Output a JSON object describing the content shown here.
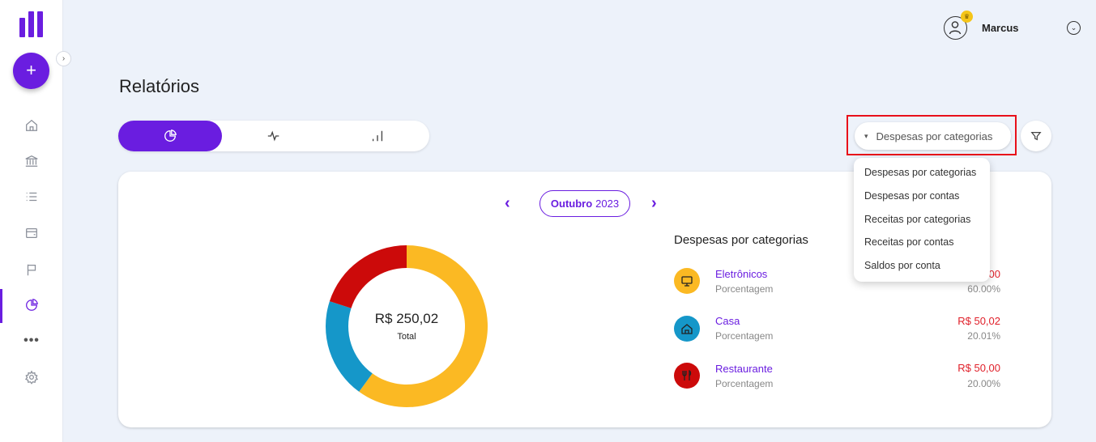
{
  "app": {
    "brand_color": "#6a1de0",
    "add_label": "+"
  },
  "sidebar": {
    "items": [
      {
        "name": "home",
        "icon": "home-icon"
      },
      {
        "name": "accounts",
        "icon": "bank-icon"
      },
      {
        "name": "transactions",
        "icon": "list-icon"
      },
      {
        "name": "cards",
        "icon": "wallet-icon"
      },
      {
        "name": "goals",
        "icon": "flag-icon"
      },
      {
        "name": "reports",
        "icon": "pie-chart-icon",
        "active": true
      },
      {
        "name": "more",
        "icon": "more-dots-icon",
        "label": "•••"
      },
      {
        "name": "settings",
        "icon": "gear-icon"
      }
    ]
  },
  "header": {
    "user_name": "Marcus"
  },
  "page": {
    "title": "Relatórios"
  },
  "chart_tabs": [
    {
      "icon": "pie-chart-icon",
      "active": true
    },
    {
      "icon": "line-chart-icon",
      "active": false
    },
    {
      "icon": "bar-chart-icon",
      "active": false
    }
  ],
  "report_select": {
    "selected": "Despesas por categorias",
    "options": [
      "Despesas por categorias",
      "Despesas por contas",
      "Receitas por categorias",
      "Receitas por contas",
      "Saldos por conta"
    ]
  },
  "period": {
    "month": "Outubro",
    "year": "2023"
  },
  "summary": {
    "total_value": "R$ 250,02",
    "total_label": "Total"
  },
  "legend": {
    "title": "Despesas por categorias",
    "items": [
      {
        "name": "Eletrônicos",
        "sub": "Porcentagem",
        "amount": ",00",
        "pct": "60.00%",
        "color": "#fbb923",
        "icon": "monitor-icon"
      },
      {
        "name": "Casa",
        "sub": "Porcentagem",
        "amount": "R$ 50,02",
        "pct": "20.01%",
        "color": "#1597c9",
        "icon": "house-icon"
      },
      {
        "name": "Restaurante",
        "sub": "Porcentagem",
        "amount": "R$ 50,00",
        "pct": "20.00%",
        "color": "#cc0a0a",
        "icon": "utensils-icon"
      }
    ]
  },
  "chart_data": {
    "type": "pie",
    "categories": [
      "Eletrônicos",
      "Casa",
      "Restaurante"
    ],
    "values": [
      60.0,
      20.01,
      20.0
    ],
    "colors": [
      "#fbb923",
      "#1597c9",
      "#cc0a0a"
    ],
    "title": "",
    "center_value": "R$ 250,02",
    "center_label": "Total"
  }
}
